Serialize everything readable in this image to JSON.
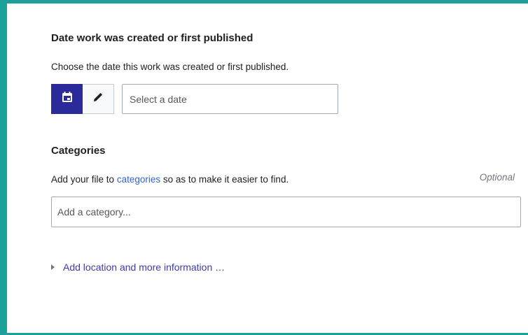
{
  "date_section": {
    "title": "Date work was created or first published",
    "help": "Choose the date this work was created or first published.",
    "calendar_icon": "calendar-icon",
    "edit_icon": "pencil-icon",
    "input_placeholder": "Select a date"
  },
  "categories_section": {
    "title": "Categories",
    "help_prefix": "Add your file to ",
    "help_link": "categories",
    "help_suffix": " so as to make it easier to find.",
    "optional": "Optional",
    "input_placeholder": "Add a category..."
  },
  "more_info": {
    "label": "Add location and more information …",
    "icon": "triangle-right-icon"
  },
  "colors": {
    "accent_border": "#1ba19a",
    "active_button": "#2a2a9b",
    "link": "#3366cc"
  }
}
